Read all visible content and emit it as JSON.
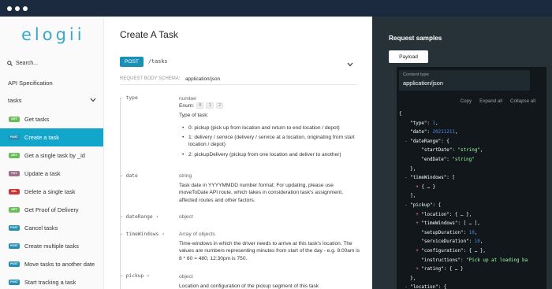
{
  "sidebar": {
    "logo": "elogii",
    "search_label": "Search...",
    "api_spec_label": "API Specification",
    "group_label": "tasks",
    "items": [
      {
        "method": "GET",
        "label": "Get tasks",
        "color": "#6bbd5b",
        "active": false
      },
      {
        "method": "POST",
        "label": "Create a task",
        "color": "#248fb2",
        "active": true
      },
      {
        "method": "GET",
        "label": "Get a single task by _id",
        "color": "#6bbd5b",
        "active": false
      },
      {
        "method": "PUT",
        "label": "Update a task",
        "color": "#9b708b",
        "active": false
      },
      {
        "method": "DEL",
        "label": "Delete a single task",
        "color": "#cc3333",
        "active": false
      },
      {
        "method": "GET",
        "label": "Get Proof of Delivery",
        "color": "#6bbd5b",
        "active": false
      },
      {
        "method": "POST",
        "label": "Cancel tasks",
        "color": "#248fb2",
        "active": false
      },
      {
        "method": "POST",
        "label": "Create multiple tasks",
        "color": "#248fb2",
        "active": false
      },
      {
        "method": "POST",
        "label": "Move tasks to another date",
        "color": "#248fb2",
        "active": false
      },
      {
        "method": "POST",
        "label": "Start tracking a task",
        "color": "#248fb2",
        "active": false
      }
    ]
  },
  "main": {
    "title": "Create A Task",
    "method": "POST",
    "path": "/tasks",
    "schema_label": "REQUEST BODY SCHEMA:",
    "schema_type": "application/json",
    "props": {
      "type": {
        "name": "type",
        "type": "number",
        "enum_label": "Enum:",
        "enum_values": [
          "0",
          "1",
          "2"
        ],
        "desc": "Type of task:",
        "bullets": [
          "0: pickup (pick up from location and return to end location / depot)",
          "1: delivery / service (delivery / service at a location, originating from start location / depot)",
          "2: pickupDelivery (pickup from one location and deliver to another)"
        ]
      },
      "date": {
        "name": "date",
        "type": "string",
        "desc": "Task date in YYYYMMDD number format; For updating, please use moveToDate API route, which takes in consideration task's assignment, affected routes and other factors."
      },
      "dateRange": {
        "name": "dateRange",
        "type": "object"
      },
      "timeWindows": {
        "name": "timeWindows",
        "type": "Array of objects",
        "desc": "Time-windows in which the driver needs to arrive at this task's location. The values are numbers representing minutes from start of the day - e.g. 8:00am is 8 * 60 = 480, 12:30pm is 750."
      },
      "pickup": {
        "name": "pickup",
        "type": "object",
        "desc": "Location and configuration of the pickup segment of this task"
      }
    }
  },
  "right": {
    "title": "Request samples",
    "payload_tab": "Payload",
    "content_type_label": "Content type",
    "content_type_value": "application/json",
    "actions": [
      "Copy",
      "Expand all",
      "Collapse all"
    ]
  }
}
